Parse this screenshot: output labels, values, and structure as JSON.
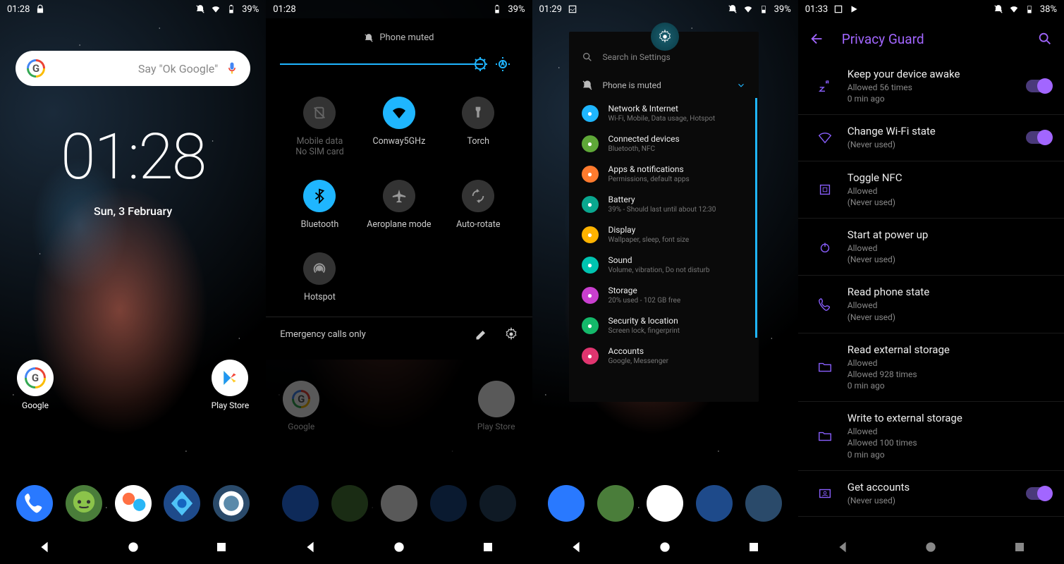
{
  "screen1": {
    "status": {
      "time": "01:28",
      "lock": "🔒",
      "battery": "39%"
    },
    "search_hint": "Say \"Ok Google\"",
    "clock": "01:28",
    "date": "Sun, 3 February",
    "apps": {
      "google": "Google",
      "playstore": "Play Store"
    }
  },
  "screen2": {
    "status": {
      "time": "01:28",
      "battery": "39%"
    },
    "muted": "Phone muted",
    "tiles": {
      "mobile": {
        "title": "Mobile data",
        "sub": "No SIM card"
      },
      "wifi": {
        "title": "Conway5GHz"
      },
      "torch": {
        "title": "Torch"
      },
      "bt": {
        "title": "Bluetooth"
      },
      "airplane": {
        "title": "Aeroplane mode"
      },
      "rotate": {
        "title": "Auto-rotate"
      },
      "hotspot": {
        "title": "Hotspot"
      }
    },
    "footer": "Emergency calls only",
    "apps": {
      "google": "Google",
      "playstore": "Play Store"
    }
  },
  "screen3": {
    "status": {
      "time": "01:29",
      "battery": "39%"
    },
    "search": "Search in Settings",
    "muted": "Phone is muted",
    "items": [
      {
        "title": "Network & Internet",
        "sub": "Wi-Fi, Mobile, Data usage, Hotspot",
        "color": "#1fb6ff"
      },
      {
        "title": "Connected devices",
        "sub": "Bluetooth, NFC",
        "color": "#5fa838"
      },
      {
        "title": "Apps & notifications",
        "sub": "Permissions, default apps",
        "color": "#ff7b2e"
      },
      {
        "title": "Battery",
        "sub": "39% - Should last until about 12:30",
        "color": "#0aa78f"
      },
      {
        "title": "Display",
        "sub": "Wallpaper, sleep, font size",
        "color": "#ffb300"
      },
      {
        "title": "Sound",
        "sub": "Volume, vibration, Do not disturb",
        "color": "#00c4b0"
      },
      {
        "title": "Storage",
        "sub": "20% used - 102 GB free",
        "color": "#c93fcf"
      },
      {
        "title": "Security & location",
        "sub": "Screen lock, fingerprint",
        "color": "#14b86a"
      },
      {
        "title": "Accounts",
        "sub": "Google, Messenger",
        "color": "#e0356f"
      }
    ]
  },
  "screen4": {
    "status": {
      "time": "01:33",
      "battery": "38%"
    },
    "title": "Privacy Guard",
    "items": [
      {
        "name": "Keep your device awake",
        "sub": "Allowed 56 times\n0 min ago",
        "icon": "sleep",
        "toggle": true
      },
      {
        "name": "Change Wi-Fi state",
        "sub": "(Never used)",
        "icon": "wifi",
        "toggle": true
      },
      {
        "name": "Toggle NFC",
        "sub": "Allowed\n(Never used)",
        "icon": "nfc"
      },
      {
        "name": "Start at power up",
        "sub": "Allowed\n(Never used)",
        "icon": "power"
      },
      {
        "name": "Read phone state",
        "sub": "Allowed\n(Never used)",
        "icon": "phone"
      },
      {
        "name": "Read external storage",
        "sub": "Allowed\nAllowed 928 times\n0 min ago",
        "icon": "folder"
      },
      {
        "name": "Write to external storage",
        "sub": "Allowed\nAllowed 100 times\n0 min ago",
        "icon": "folder"
      },
      {
        "name": "Get accounts",
        "sub": "(Never used)",
        "icon": "accounts",
        "toggle": true
      }
    ]
  }
}
